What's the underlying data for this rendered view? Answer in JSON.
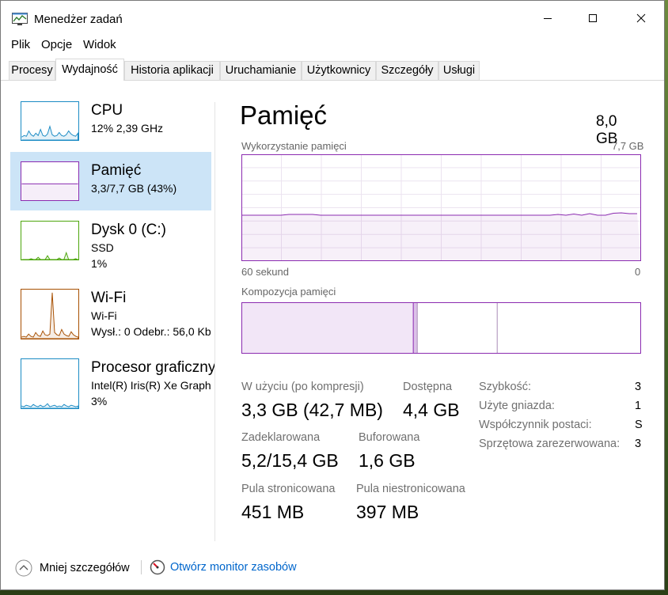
{
  "window": {
    "title": "Menedżer zadań"
  },
  "menu": [
    "Plik",
    "Opcje",
    "Widok"
  ],
  "tabs": [
    "Procesy",
    "Wydajność",
    "Historia aplikacji",
    "Uruchamianie",
    "Użytkownicy",
    "Szczegóły",
    "Usługi"
  ],
  "active_tab": "Wydajność",
  "sidebar": [
    {
      "title": "CPU",
      "lines": [
        "12%  2,39 GHz"
      ],
      "color": "#1b8bc4",
      "selected": false
    },
    {
      "title": "Pamięć",
      "lines": [
        "3,3/7,7 GB (43%)"
      ],
      "color": "#8b2bb0",
      "selected": true
    },
    {
      "title": "Dysk 0 (C:)",
      "lines": [
        "SSD",
        "1%"
      ],
      "color": "#4da60c",
      "selected": false
    },
    {
      "title": "Wi-Fi",
      "lines": [
        "Wi-Fi",
        "Wysł.: 0  Odebr.: 56,0 Kb"
      ],
      "color": "#a74f01",
      "selected": false
    },
    {
      "title": "Procesor graficzny",
      "lines": [
        "Intel(R) Iris(R) Xe Graph",
        "3%"
      ],
      "color": "#1b8bc4",
      "selected": false
    }
  ],
  "main": {
    "heading": "Pamięć",
    "total": "8,0 GB",
    "usage_graph": {
      "label": "Wykorzystanie pamięci",
      "max_label": "7,7 GB",
      "time_label": "60 sekund",
      "zero_label": "0",
      "level_percent": 43
    },
    "composition": {
      "label": "Kompozycja pamięci",
      "in_use_percent": 43,
      "modified_percent": 1,
      "standby_percent": 20,
      "free_percent": 36
    },
    "stats": {
      "in_use_label": "W użyciu (po kompresji)",
      "in_use_value": "3,3 GB (42,7 MB)",
      "available_label": "Dostępna",
      "available_value": "4,4 GB",
      "committed_label": "Zadeklarowana",
      "committed_value": "5,2/15,4 GB",
      "cached_label": "Buforowana",
      "cached_value": "1,6 GB",
      "paged_label": "Pula stronicowana",
      "paged_value": "451 MB",
      "nonpaged_label": "Pula niestronicowana",
      "nonpaged_value": "397 MB"
    },
    "details": [
      {
        "label": "Szybkość:",
        "value": "3"
      },
      {
        "label": "Użyte gniazda:",
        "value": "1"
      },
      {
        "label": "Współczynnik postaci:",
        "value": "S"
      },
      {
        "label": "Sprzętowa zarezerwowana:",
        "value": "3"
      }
    ]
  },
  "footer": {
    "fewer_details": "Mniej szczegółów",
    "resource_monitor": "Otwórz monitor zasobów"
  }
}
